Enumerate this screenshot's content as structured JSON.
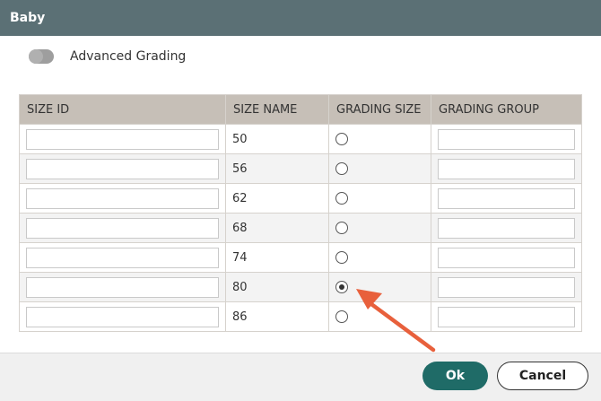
{
  "dialog": {
    "title": "Baby"
  },
  "toggle": {
    "label": "Advanced Grading",
    "on": false
  },
  "table": {
    "headers": [
      "SIZE ID",
      "SIZE NAME",
      "GRADING SIZE",
      "GRADING GROUP"
    ],
    "rows": [
      {
        "size_id": "",
        "size_name": "50",
        "grading_selected": false,
        "grading_group": ""
      },
      {
        "size_id": "",
        "size_name": "56",
        "grading_selected": false,
        "grading_group": ""
      },
      {
        "size_id": "",
        "size_name": "62",
        "grading_selected": false,
        "grading_group": ""
      },
      {
        "size_id": "",
        "size_name": "68",
        "grading_selected": false,
        "grading_group": ""
      },
      {
        "size_id": "",
        "size_name": "74",
        "grading_selected": false,
        "grading_group": ""
      },
      {
        "size_id": "",
        "size_name": "80",
        "grading_selected": true,
        "grading_group": ""
      },
      {
        "size_id": "",
        "size_name": "86",
        "grading_selected": false,
        "grading_group": ""
      }
    ]
  },
  "footer": {
    "ok_label": "Ok",
    "cancel_label": "Cancel"
  },
  "colors": {
    "titlebar": "#5b7075",
    "ok_button": "#1f6b67",
    "annotation_arrow": "#e8603c"
  }
}
